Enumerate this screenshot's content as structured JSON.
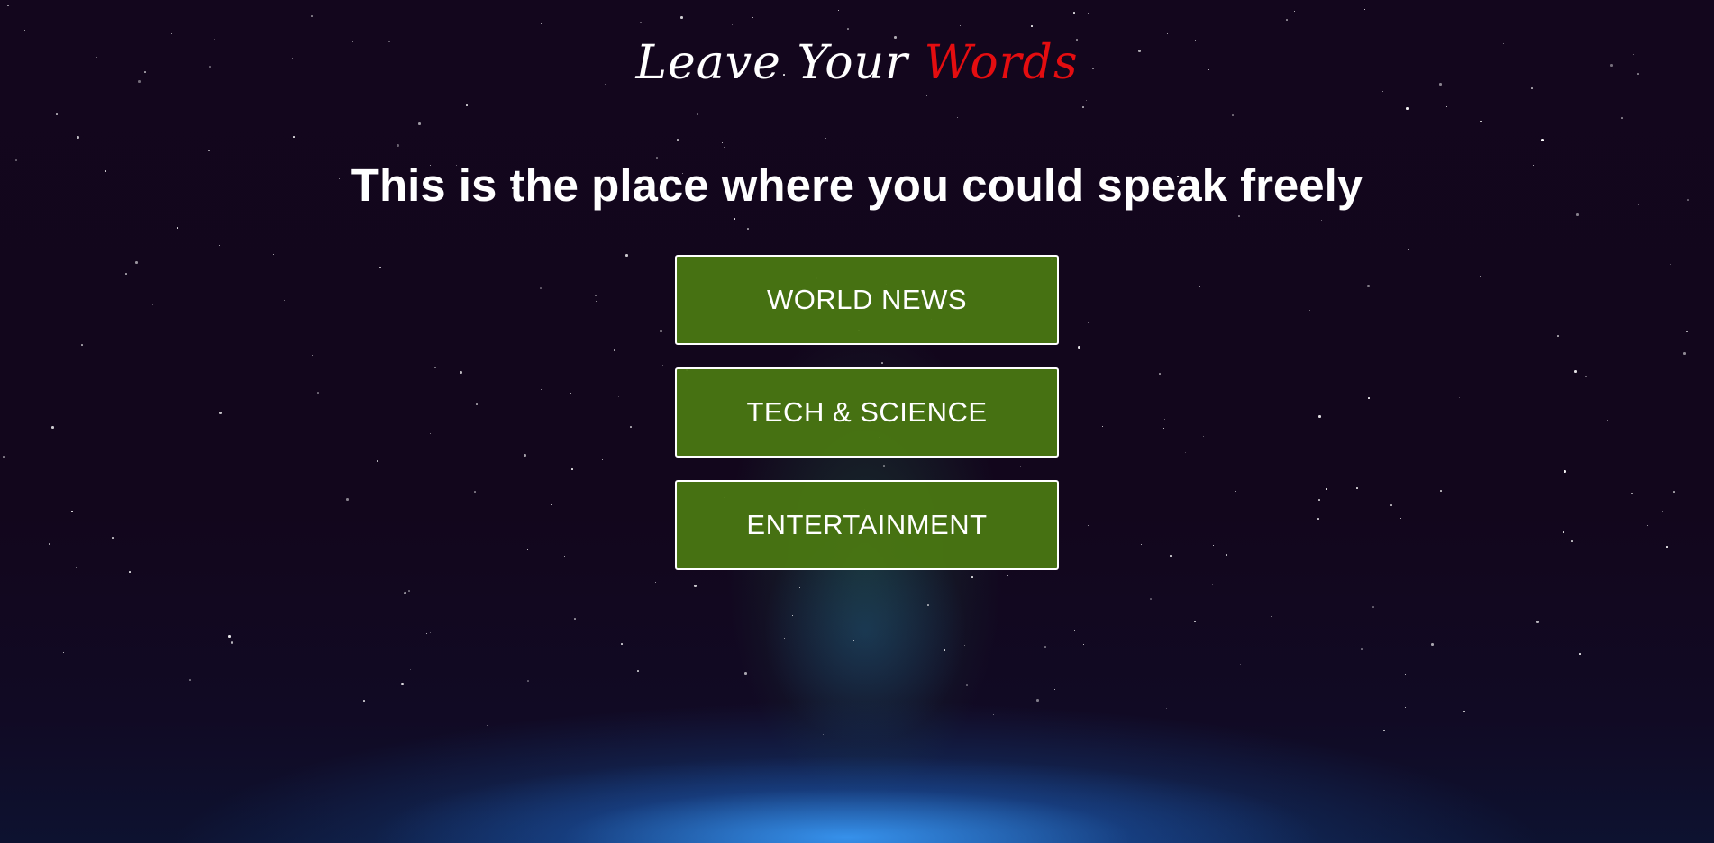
{
  "brand": {
    "title_plain": "Leave Your ",
    "title_accent": "Words",
    "accent_color": "#e40d10"
  },
  "headline": "This is the place where you could speak freely",
  "menu": {
    "button_color": "#497612",
    "items": [
      {
        "label": "WORLD NEWS"
      },
      {
        "label": "TECH & SCIENCE"
      },
      {
        "label": "ENTERTAINMENT"
      }
    ]
  }
}
